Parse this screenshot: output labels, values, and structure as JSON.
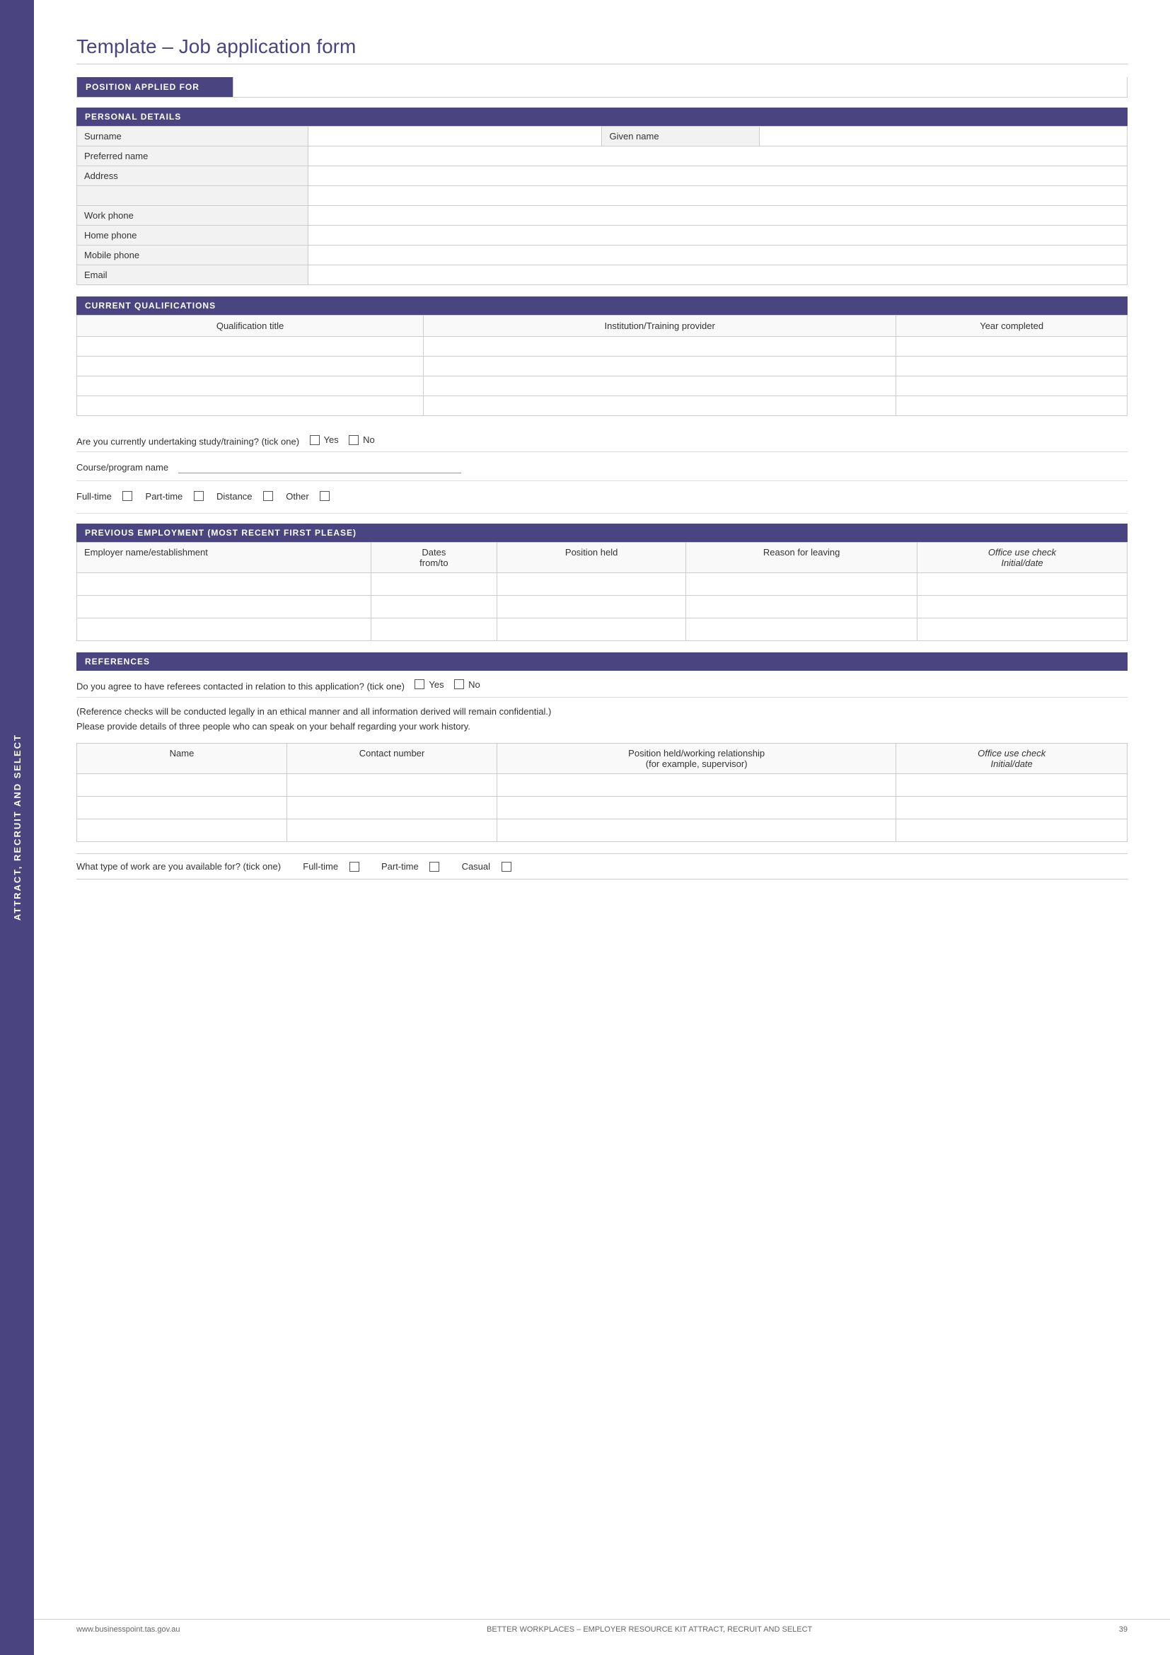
{
  "page": {
    "title": "Template – Job application form",
    "side_tab": "ATTRACT, RECRUIT AND SELECT"
  },
  "sections": {
    "position_applied_for": {
      "label": "POSITION APPLIED FOR"
    },
    "personal_details": {
      "label": "PERSONAL DETAILS",
      "fields": [
        {
          "label": "Surname",
          "paired_label": "Given name"
        },
        {
          "label": "Preferred name"
        },
        {
          "label": "Address"
        },
        {
          "label": ""
        },
        {
          "label": "Work phone"
        },
        {
          "label": "Home phone"
        },
        {
          "label": "Mobile phone"
        },
        {
          "label": "Email"
        }
      ]
    },
    "current_qualifications": {
      "label": "CURRENT QUALIFICATIONS",
      "col1": "Qualification title",
      "col2": "Institution/Training provider",
      "col3": "Year completed"
    },
    "study_training": {
      "question": "Are you currently undertaking study/training? (tick one)",
      "yes": "Yes",
      "no": "No",
      "course_label": "Course/program name",
      "modes": [
        "Full-time",
        "Part-time",
        "Distance",
        "Other"
      ]
    },
    "previous_employment": {
      "label": "PREVIOUS EMPLOYMENT (MOST RECENT FIRST PLEASE)",
      "col1": "Employer name/establishment",
      "col2_a": "Dates",
      "col2_b": "from/to",
      "col3": "Position held",
      "col4": "Reason for leaving",
      "col5_a": "Office use check",
      "col5_b": "Initial/date"
    },
    "references": {
      "label": "REFERENCES",
      "question": "Do you agree to have referees contacted in relation to this application? (tick one)",
      "yes": "Yes",
      "no": "No",
      "note1": "(Reference checks will be conducted legally in an ethical manner and all information derived will remain confidential.)",
      "note2": "Please provide details of three people who can speak on your behalf regarding your work history.",
      "col1": "Name",
      "col2": "Contact number",
      "col3_a": "Position held/working relationship",
      "col3_b": "(for example, supervisor)",
      "col4_a": "Office use check",
      "col4_b": "Initial/date"
    },
    "work_availability": {
      "question": "What type of work are you available for? (tick one)",
      "types": [
        "Full-time",
        "Part-time",
        "Casual"
      ]
    }
  },
  "footer": {
    "left": "www.businesspoint.tas.gov.au",
    "center": "BETTER WORKPLACES – EMPLOYER RESOURCE KIT ATTRACT, RECRUIT AND SELECT",
    "right": "39"
  }
}
